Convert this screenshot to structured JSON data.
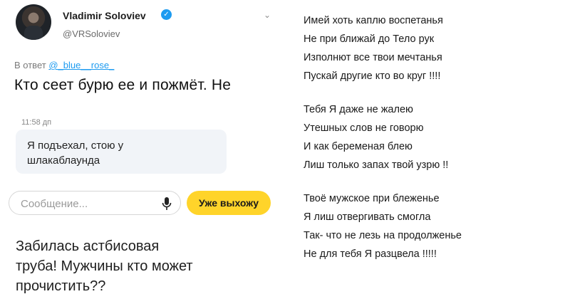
{
  "tweet": {
    "author_name": "Vladimir Soloviev",
    "handle": "@VRSoloviev",
    "reply_prefix": "В ответ",
    "reply_mention": "@_blue__rose_",
    "text": "Кто сеет бурю ее и пожмёт. Не"
  },
  "chat": {
    "time": "11:58 дп",
    "message_lines": [
      "Я подъехал, стою у",
      "шлакаблаунда"
    ],
    "input_placeholder": "Сообщение...",
    "quick_reply_label": "Уже выхожу",
    "colors": {
      "accent": "#ffd42a",
      "bubble": "#f1f4f8"
    }
  },
  "caption": {
    "lines": [
      "Забилась астбисовая",
      "труба! Мужчины кто может",
      "прочистить??"
    ]
  },
  "poem": {
    "stanzas": [
      [
        "Имей хоть каплю воспетанья",
        "Не при ближай до Тело рук",
        "Изполнют все твои мечтанья",
        "Пускай другие кто во круг !!!!"
      ],
      [
        "Тебя Я даже не жалею",
        "Утешных слов не говорю",
        "И как беременая блею",
        "Лиш только запах твой узрю !!"
      ],
      [
        "Твоё мужское при блеженье",
        "Я лиш отвергивать смогла",
        "Так- что не лезь на продолженье",
        "Не для тебя Я разцвела !!!!!"
      ]
    ]
  }
}
